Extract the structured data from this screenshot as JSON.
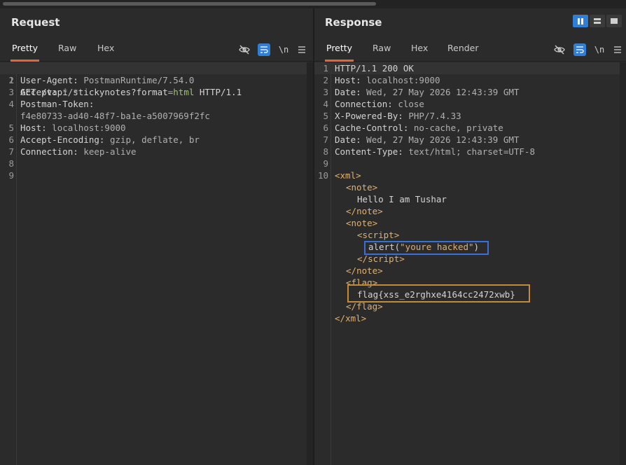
{
  "request": {
    "title": "Request",
    "tabs": [
      "Pretty",
      "Raw",
      "Hex"
    ],
    "active_tab": "Pretty",
    "tools": {
      "hide_icon": "eye-off-icon",
      "wrap_icon": "word-wrap-icon",
      "newline_label": "\\n",
      "menu_icon": "hamburger-menu-icon"
    },
    "lines": [
      {
        "n": "1",
        "method": "GET",
        "path": " /vapi/stickynotes?format",
        "eq": "=",
        "val": "html",
        "proto": " HTTP/1.1"
      },
      {
        "n": "2",
        "k": "User-Agent:",
        "v": " PostmanRuntime/7.54.0"
      },
      {
        "n": "3",
        "k": "Accept:",
        "v": " */*"
      },
      {
        "n": "4",
        "k": "Postman-Token:",
        "v": ""
      },
      {
        "n": "",
        "k": "",
        "v": "f4e80733-ad40-48f7-ba1e-a5007969f2fc"
      },
      {
        "n": "5",
        "k": "Host:",
        "v": " localhost:9000"
      },
      {
        "n": "6",
        "k": "Accept-Encoding:",
        "v": " gzip, deflate, br"
      },
      {
        "n": "7",
        "k": "Connection:",
        "v": " keep-alive"
      },
      {
        "n": "8",
        "k": "",
        "v": ""
      },
      {
        "n": "9",
        "k": "",
        "v": ""
      }
    ]
  },
  "response": {
    "title": "Response",
    "tabs": [
      "Pretty",
      "Raw",
      "Hex",
      "Render"
    ],
    "active_tab": "Pretty",
    "tools": {
      "hide_icon": "eye-off-icon",
      "wrap_icon": "word-wrap-icon",
      "newline_label": "\\n",
      "menu_icon": "hamburger-menu-icon"
    },
    "layout_toggle": [
      "side-by-side-icon",
      "stacked-icon",
      "single-pane-icon"
    ],
    "headers": [
      {
        "n": "1",
        "k": "HTTP/1.1 200 OK",
        "v": ""
      },
      {
        "n": "2",
        "k": "Host:",
        "v": " localhost:9000"
      },
      {
        "n": "3",
        "k": "Date:",
        "v": " Wed, 27 May 2026 12:43:39 GMT"
      },
      {
        "n": "4",
        "k": "Connection:",
        "v": " close"
      },
      {
        "n": "5",
        "k": "X-Powered-By:",
        "v": " PHP/7.4.33"
      },
      {
        "n": "6",
        "k": "Cache-Control:",
        "v": " no-cache, private"
      },
      {
        "n": "7",
        "k": "Date:",
        "v": " Wed, 27 May 2026 12:43:39 GMT"
      },
      {
        "n": "8",
        "k": "Content-Type:",
        "v": " text/html; charset=UTF-8"
      },
      {
        "n": "9",
        "k": "",
        "v": ""
      }
    ],
    "body": {
      "line_no": "10",
      "xml_open": "xml",
      "note_tag": "note",
      "note_text": "Hello I am Tushar",
      "script_tag": "script",
      "alert_fn": "alert(",
      "alert_str": "\"youre hacked\"",
      "alert_close": ")",
      "flag_tag": "flag",
      "flag_text": "flag{xss_e2rghxe4164cc2472xwb}"
    }
  },
  "colors": {
    "accent_tab": "#e8652b",
    "active_button": "#2f7fd6",
    "highlight_blue": "#3a6fd8",
    "highlight_orange": "#c98a2f"
  }
}
